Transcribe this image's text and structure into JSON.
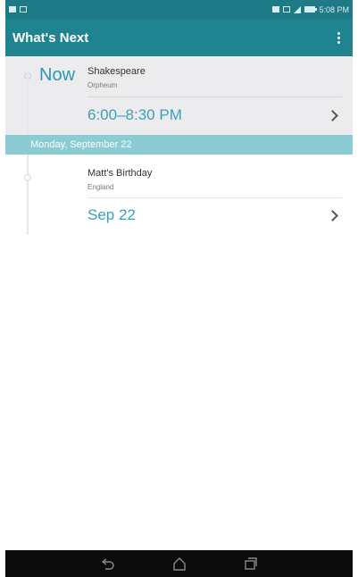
{
  "status_bar": {
    "time": "5:08 PM"
  },
  "app_bar": {
    "title": "What's Next"
  },
  "now_event": {
    "now_label": "Now",
    "title": "Shakespeare",
    "location": "Orpheum",
    "time_range": "6:00–8:30 PM"
  },
  "date_header": {
    "label": "Monday, September 22"
  },
  "birthday_event": {
    "title": "Matt's Birthday",
    "location": "England",
    "date": "Sep 22"
  },
  "colors": {
    "app_bar": "#1f848f",
    "status_bar": "#1e7b86",
    "accent_text": "#39a0ba",
    "date_header": "#8bcbd3",
    "now_card": "#ececee",
    "nav_bar": "#0b0b0b"
  },
  "icons": {
    "overflow": "more-vert-icon",
    "chevron": "chevron-right-icon",
    "back": "back-icon",
    "home": "home-icon",
    "recents": "recents-icon"
  }
}
